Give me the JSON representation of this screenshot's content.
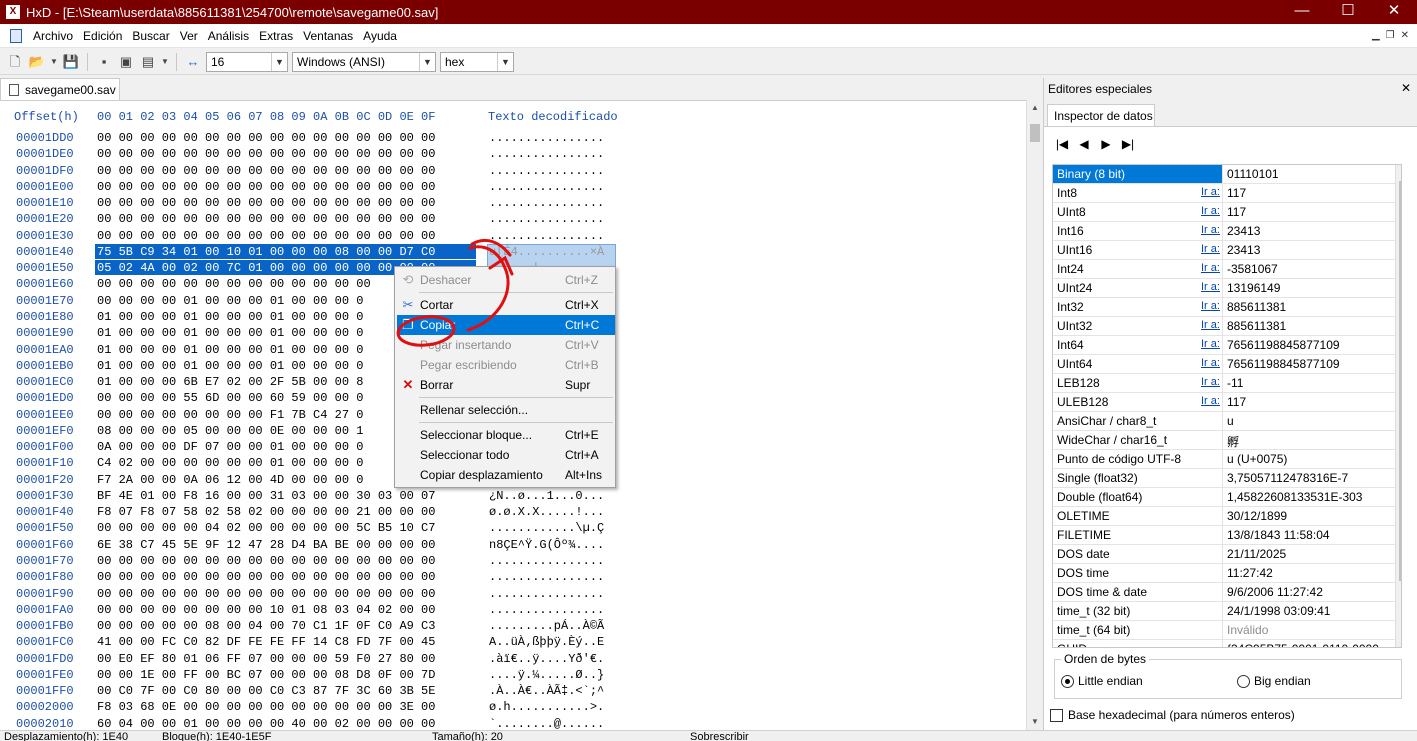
{
  "window": {
    "title": "HxD - [E:\\Steam\\userdata\\885611381\\254700\\remote\\savegame00.sav]",
    "app_icon": "hxd-icon",
    "min": "—",
    "max": "☐",
    "close": "✕"
  },
  "menu": [
    "Archivo",
    "Edición",
    "Buscar",
    "Ver",
    "Análisis",
    "Extras",
    "Ventanas",
    "Ayuda"
  ],
  "toolbar": {
    "bytes_per_row": "16",
    "charset": "Windows (ANSI)",
    "display_mode": "hex"
  },
  "tab": {
    "label": "savegame00.sav"
  },
  "hex": {
    "header_offset": "Offset(h)",
    "header_cols": "00 01 02 03 04 05 06 07 08 09 0A 0B 0C 0D 0E 0F",
    "header_text": "Texto decodificado",
    "rows": [
      {
        "off": "00001DD0",
        "bytes": "00 00 00 00 00 00 00 00 00 00 00 00 00 00 00 00",
        "txt": "................"
      },
      {
        "off": "00001DE0",
        "bytes": "00 00 00 00 00 00 00 00 00 00 00 00 00 00 00 00",
        "txt": "................"
      },
      {
        "off": "00001DF0",
        "bytes": "00 00 00 00 00 00 00 00 00 00 00 00 00 00 00 00",
        "txt": "................"
      },
      {
        "off": "00001E00",
        "bytes": "00 00 00 00 00 00 00 00 00 00 00 00 00 00 00 00",
        "txt": "................"
      },
      {
        "off": "00001E10",
        "bytes": "00 00 00 00 00 00 00 00 00 00 00 00 00 00 00 00",
        "txt": "................"
      },
      {
        "off": "00001E20",
        "bytes": "00 00 00 00 00 00 00 00 00 00 00 00 00 00 00 00",
        "txt": "................"
      },
      {
        "off": "00001E30",
        "bytes": "00 00 00 00 00 00 00 00 00 00 00 00 00 00 00 00",
        "txt": "................"
      },
      {
        "off": "00001E40",
        "bytes": "75 5B C9 34 01 00 10 01 00 00 00 08 00 00 D7 C0",
        "txt": "u[É4..........×À"
      },
      {
        "off": "00001E50",
        "bytes": "05 02 4A 00 02 00 7C 01 00 00 00 00 00 00 00 00",
        "txt": "..J...|........."
      },
      {
        "off": "00001E60",
        "bytes": "00 00 00 00 00 00 00 00 00 00 00 00 00",
        "txt": ""
      },
      {
        "off": "00001E70",
        "bytes": "00 00 00 00 01 00 00 00 01 00 00 00 0",
        "txt": ""
      },
      {
        "off": "00001E80",
        "bytes": "01 00 00 00 01 00 00 00 01 00 00 00 0",
        "txt": ""
      },
      {
        "off": "00001E90",
        "bytes": "01 00 00 00 01 00 00 00 01 00 00 00 0",
        "txt": ""
      },
      {
        "off": "00001EA0",
        "bytes": "01 00 00 00 01 00 00 00 01 00 00 00 0",
        "txt": ""
      },
      {
        "off": "00001EB0",
        "bytes": "01 00 00 00 01 00 00 00 01 00 00 00 0",
        "txt": ""
      },
      {
        "off": "00001EC0",
        "bytes": "01 00 00 00 6B E7 02 00 2F 5B 00 00 8",
        "txt": ""
      },
      {
        "off": "00001ED0",
        "bytes": "00 00 00 00 55 6D 00 00 60 59 00 00 0",
        "txt": ""
      },
      {
        "off": "00001EE0",
        "bytes": "00 00 00 00 00 00 00 00 F1 7B C4 27 0",
        "txt": ""
      },
      {
        "off": "00001EF0",
        "bytes": "08 00 00 00 05 00 00 00 0E 00 00 00 1",
        "txt": ""
      },
      {
        "off": "00001F00",
        "bytes": "0A 00 00 00 DF 07 00 00 01 00 00 00 0",
        "txt": ""
      },
      {
        "off": "00001F10",
        "bytes": "C4 02 00 00 00 00 00 00 01 00 00 00 0",
        "txt": ""
      },
      {
        "off": "00001F20",
        "bytes": "F7 2A 00 00 0A 06 12 00 4D 00 00 00 0",
        "txt": ""
      },
      {
        "off": "00001F30",
        "bytes": "BF 4E 01 00 F8 16 00 00 31 03 00 00 30 03 00 07",
        "txt": "¿N..ø...1...0..."
      },
      {
        "off": "00001F40",
        "bytes": "F8 07 F8 07 58 02 58 02 00 00 00 00 21 00 00 00",
        "txt": "ø.ø.X.X.....!..."
      },
      {
        "off": "00001F50",
        "bytes": "00 00 00 00 00 04 02 00 00 00 00 00 5C B5 10 C7",
        "txt": "............\\µ.Ç"
      },
      {
        "off": "00001F60",
        "bytes": "6E 38 C7 45 5E 9F 12 47 28 D4 BA BE 00 00 00 00",
        "txt": "n8ÇE^Ÿ.G(Ôº¾...."
      },
      {
        "off": "00001F70",
        "bytes": "00 00 00 00 00 00 00 00 00 00 00 00 00 00 00 00",
        "txt": "................"
      },
      {
        "off": "00001F80",
        "bytes": "00 00 00 00 00 00 00 00 00 00 00 00 00 00 00 00",
        "txt": "................"
      },
      {
        "off": "00001F90",
        "bytes": "00 00 00 00 00 00 00 00 00 00 00 00 00 00 00 00",
        "txt": "................"
      },
      {
        "off": "00001FA0",
        "bytes": "00 00 00 00 00 00 00 00 10 01 08 03 04 02 00 00",
        "txt": "................"
      },
      {
        "off": "00001FB0",
        "bytes": "00 00 00 00 00 08 00 04 00 70 C1 1F 0F C0 A9 C3",
        "txt": ".........pÁ..À©Ã"
      },
      {
        "off": "00001FC0",
        "bytes": "41 00 00 FC C0 82 DF FE FE FF 14 C8 FD 7F 00 45",
        "txt": "A..üÀ‚ßþþÿ.Èý..E"
      },
      {
        "off": "00001FD0",
        "bytes": "00 E0 EF 80 01 06 FF 07 00 00 00 59 F0 27 80 00",
        "txt": ".àï€..ÿ....Yð'€."
      },
      {
        "off": "00001FE0",
        "bytes": "00 00 1E 00 FF 00 BC 07 00 00 00 08 D8 0F 00 7D",
        "txt": "....ÿ.¼.....Ø..}"
      },
      {
        "off": "00001FF0",
        "bytes": "00 C0 7F 00 C0 80 00 00 C0 C3 87 7F 3C 60 3B 5E",
        "txt": ".À..À€..ÀÃ‡.<`;^"
      },
      {
        "off": "00002000",
        "bytes": "F8 03 68 0E 00 00 00 00 00 00 00 00 00 00 3E 00",
        "txt": "ø.h...........>."
      },
      {
        "off": "00002010",
        "bytes": "60 04 00 00 01 00 00 00 00 40 00 02 00 00 00 00",
        "txt": "`........@......"
      }
    ]
  },
  "context_menu": {
    "items": [
      {
        "label": "Deshacer",
        "key": "Ctrl+Z",
        "icon": "undo-icon",
        "state": "disabled"
      },
      {
        "label": "Cortar",
        "key": "Ctrl+X",
        "icon": "scissors-icon",
        "state": "normal"
      },
      {
        "label": "Copiar",
        "key": "Ctrl+C",
        "icon": "copy-icon",
        "state": "active"
      },
      {
        "label": "Pegar insertando",
        "key": "Ctrl+V",
        "icon": "",
        "state": "disabled"
      },
      {
        "label": "Pegar escribiendo",
        "key": "Ctrl+B",
        "icon": "",
        "state": "disabled"
      },
      {
        "label": "Borrar",
        "key": "Supr",
        "icon": "delete-x-icon",
        "state": "normal"
      },
      {
        "label": "Rellenar selección...",
        "key": "",
        "icon": "",
        "state": "normal"
      },
      {
        "label": "Seleccionar bloque...",
        "key": "Ctrl+E",
        "icon": "",
        "state": "normal"
      },
      {
        "label": "Seleccionar todo",
        "key": "Ctrl+A",
        "icon": "",
        "state": "normal"
      },
      {
        "label": "Copiar desplazamiento",
        "key": "Alt+Ins",
        "icon": "",
        "state": "normal"
      }
    ]
  },
  "right_panel": {
    "title": "Editores especiales",
    "tab": "Inspector de datos",
    "goto_label": "Ir a:",
    "inspector": [
      {
        "name": "Binary (8 bit)",
        "value": "01110101",
        "goto": false,
        "selected": true
      },
      {
        "name": "Int8",
        "value": "117",
        "goto": true
      },
      {
        "name": "UInt8",
        "value": "117",
        "goto": true
      },
      {
        "name": "Int16",
        "value": "23413",
        "goto": true
      },
      {
        "name": "UInt16",
        "value": "23413",
        "goto": true
      },
      {
        "name": "Int24",
        "value": "-3581067",
        "goto": true
      },
      {
        "name": "UInt24",
        "value": "13196149",
        "goto": true
      },
      {
        "name": "Int32",
        "value": "885611381",
        "goto": true
      },
      {
        "name": "UInt32",
        "value": "885611381",
        "goto": true
      },
      {
        "name": "Int64",
        "value": "76561198845877109",
        "goto": true
      },
      {
        "name": "UInt64",
        "value": "76561198845877109",
        "goto": true
      },
      {
        "name": "LEB128",
        "value": "-11",
        "goto": true
      },
      {
        "name": "ULEB128",
        "value": "117",
        "goto": true
      },
      {
        "name": "AnsiChar / char8_t",
        "value": "u",
        "goto": false
      },
      {
        "name": "WideChar / char16_t",
        "value": "孵",
        "goto": false
      },
      {
        "name": "Punto de código UTF-8",
        "value": "u (U+0075)",
        "goto": false
      },
      {
        "name": "Single (float32)",
        "value": "3,75057112478316E-7",
        "goto": false
      },
      {
        "name": "Double (float64)",
        "value": "1,45822608133531E-303",
        "goto": false
      },
      {
        "name": "OLETIME",
        "value": "30/12/1899",
        "goto": false
      },
      {
        "name": "FILETIME",
        "value": "13/8/1843 11:58:04",
        "goto": false
      },
      {
        "name": "DOS date",
        "value": "21/11/2025",
        "goto": false
      },
      {
        "name": "DOS time",
        "value": "11:27:42",
        "goto": false
      },
      {
        "name": "DOS time & date",
        "value": "9/6/2006 11:27:42",
        "goto": false
      },
      {
        "name": "time_t (32 bit)",
        "value": "24/1/1998 03:09:41",
        "goto": false
      },
      {
        "name": "time_t (64 bit)",
        "value": "Inválido",
        "goto": false,
        "muted": true
      },
      {
        "name": "GUID",
        "value": "{34C95B75-0001-0110-0000-000",
        "goto": false
      }
    ],
    "byte_order": {
      "legend": "Orden de bytes",
      "little": "Little endian",
      "big": "Big endian",
      "selected": "little"
    },
    "hex_base_label": "Base hexadecimal (para números enteros)",
    "hex_base_checked": false
  },
  "status": {
    "offset": "Desplazamiento(h): 1E40",
    "block": "Bloque(h): 1E40-1E5F",
    "length": "Tamaño(h): 20",
    "mode": "Sobrescribir"
  },
  "colors": {
    "titlebar": "#7a0000",
    "selection": "#0a64c8",
    "menu_highlight": "#0078d7",
    "annotation": "#e01010"
  }
}
